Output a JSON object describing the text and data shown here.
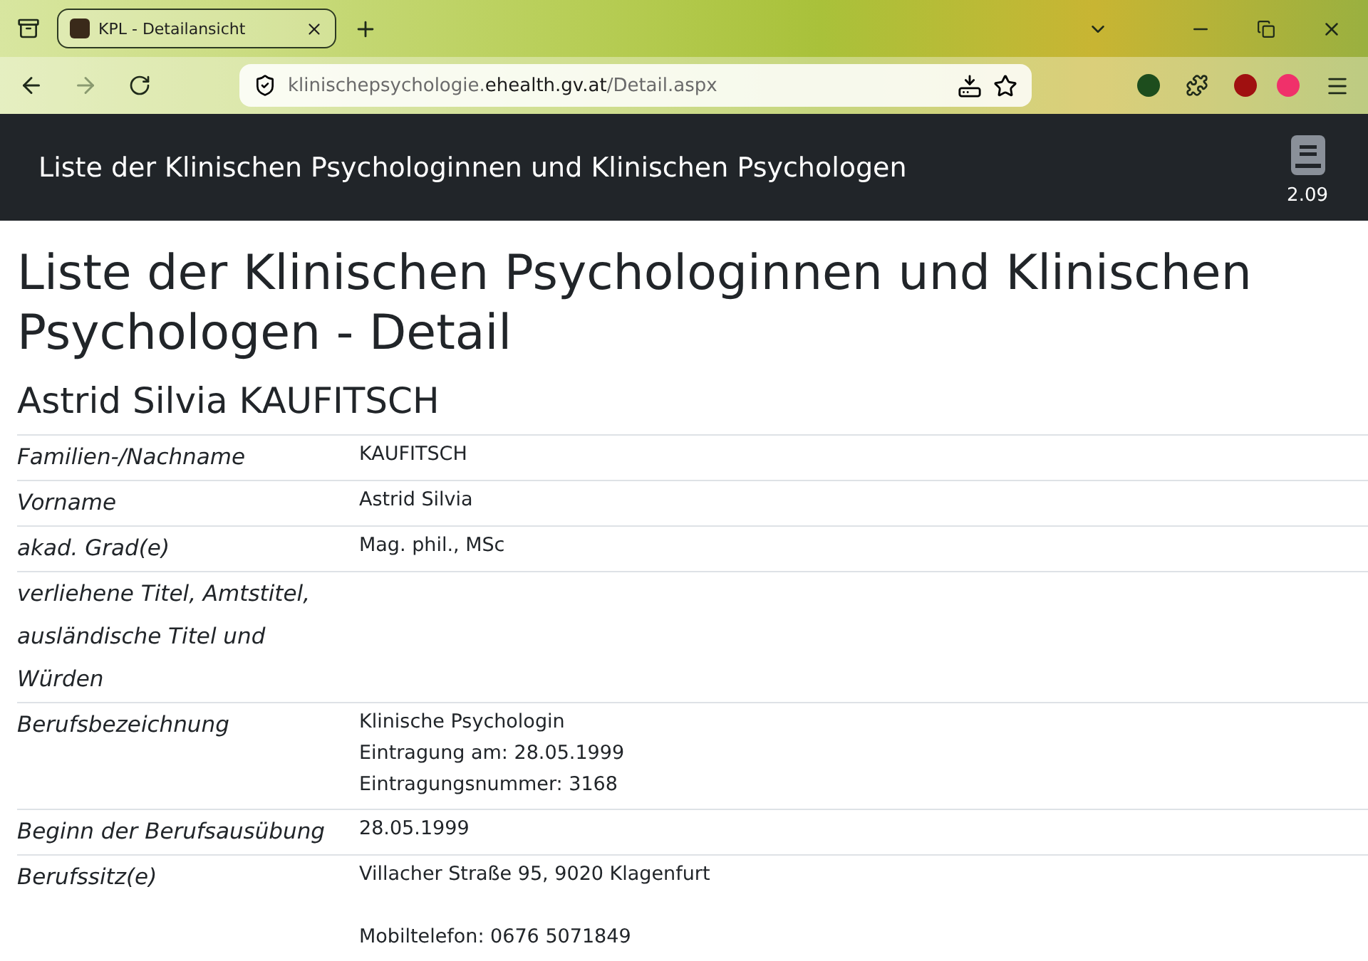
{
  "browser": {
    "tab": {
      "title": "KPL - Detailansicht",
      "selected": true
    },
    "url": {
      "prefix": "klinischepsychologie.",
      "domain": "ehealth.gv.at",
      "path": "/Detail.aspx"
    }
  },
  "header": {
    "title": "Liste der Klinischen Psychologinnen und Klinischen Psychologen",
    "version": "2.09"
  },
  "page_title": "Liste der Klinischen Psychologinnen und Klinischen Psychologen - Detail",
  "person_name": "Astrid Silvia KAUFITSCH",
  "details": [
    {
      "label": "Familien-/Nachname",
      "value": [
        [
          "KAUFITSCH"
        ]
      ]
    },
    {
      "label": "Vorname",
      "value": [
        [
          "Astrid Silvia"
        ]
      ]
    },
    {
      "label": "akad. Grad(e)",
      "value": [
        [
          "Mag. phil., MSc"
        ]
      ]
    },
    {
      "label": "verliehene Titel, Amtstitel, ausländische Titel und Würden"
    },
    {
      "label": "Berufsbezeichnung",
      "value": [
        [
          "Klinische Psychologin",
          "Eintragung am: 28.05.1999",
          "Eintragungsnummer: 3168"
        ]
      ]
    },
    {
      "label": "Beginn der Berufsausübung",
      "value": [
        [
          "28.05.1999"
        ]
      ]
    },
    {
      "label": "Berufssitz(e)",
      "value": [
        [
          "Villacher Straße 95, 9020 Klagenfurt"
        ],
        [
          "Mobiltelefon: 0676 5071849"
        ]
      ]
    }
  ]
}
